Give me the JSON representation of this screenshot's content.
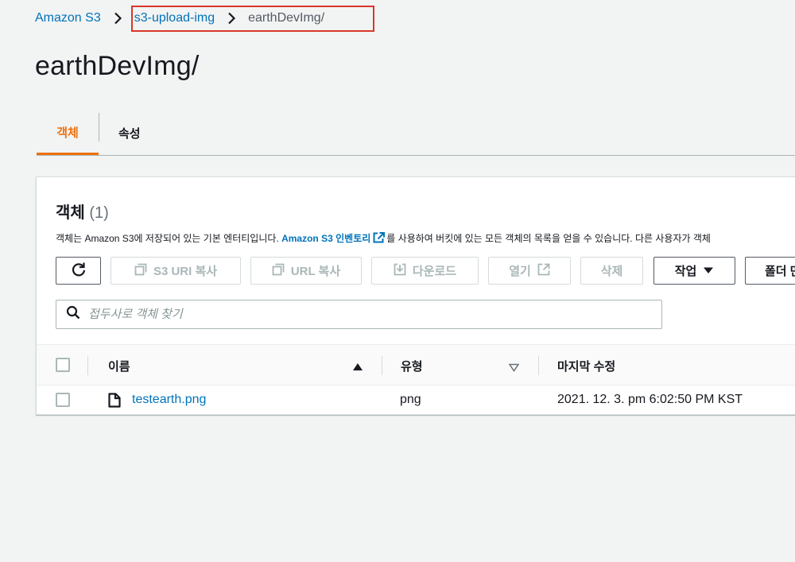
{
  "breadcrumb": {
    "root": "Amazon S3",
    "bucket": "s3-upload-img",
    "current": "earthDevImg/"
  },
  "page": {
    "title": "earthDevImg/"
  },
  "tabs": [
    {
      "label": "객체",
      "active": true
    },
    {
      "label": "속성",
      "active": false
    }
  ],
  "objects": {
    "title": "객체",
    "count": "(1)",
    "desc_prefix": "객체는 Amazon S3에 저장되어 있는 기본 엔터티입니다. ",
    "desc_link": "Amazon S3 인벤토리",
    "desc_suffix": "를 사용하여 버킷에 있는 모든 객체의 목록을 얻을 수 있습니다. 다른 사용자가 객체",
    "toolbar": {
      "copy_s3_uri": "S3 URI 복사",
      "copy_url": "URL 복사",
      "download": "다운로드",
      "open": "열기",
      "delete": "삭제",
      "actions": "작업",
      "create_folder": "폴더 만"
    },
    "search": {
      "placeholder": "접두사로 객체 찾기"
    },
    "columns": {
      "name": "이름",
      "type": "유형",
      "modified": "마지막 수정"
    },
    "rows": [
      {
        "name": "testearth.png",
        "type": "png",
        "modified": "2021. 12. 3. pm 6:02:50 PM KST"
      }
    ]
  },
  "colors": {
    "link": "#0073bb",
    "accent": "#ec7211",
    "highlight": "#d9362b"
  },
  "icons": [
    "chevron-right-icon",
    "refresh-icon",
    "copy-icon",
    "download-icon",
    "external-link-icon",
    "caret-down-icon",
    "search-icon",
    "sort-up-icon",
    "sort-down-icon",
    "file-icon"
  ]
}
